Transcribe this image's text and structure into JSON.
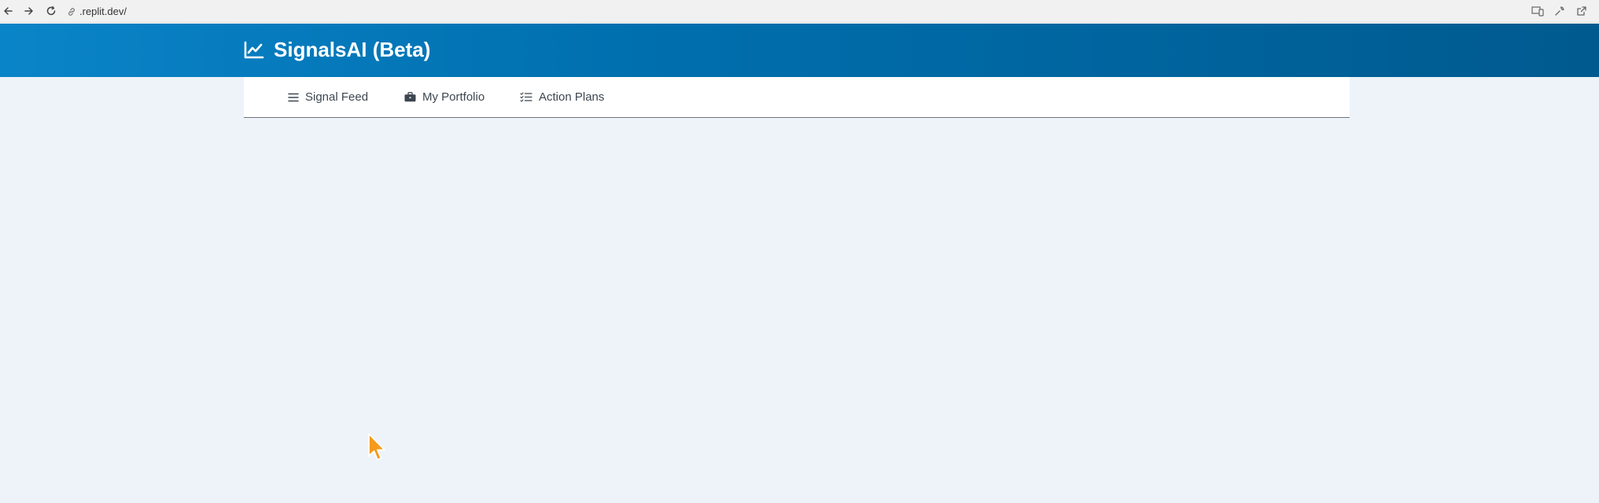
{
  "browser": {
    "url": ".replit.dev/"
  },
  "app": {
    "title": "SignalsAI (Beta)",
    "nav": [
      {
        "label": "Signal Feed",
        "icon": "list-icon"
      },
      {
        "label": "My Portfolio",
        "icon": "briefcase-icon"
      },
      {
        "label": "Action Plans",
        "icon": "checklist-icon"
      }
    ]
  },
  "colors": {
    "header_start": "#0a84c8",
    "header_end": "#005a8f",
    "page_background": "#eef3fa",
    "nav_text": "#3d4650",
    "cursor": "#f59a1b"
  }
}
